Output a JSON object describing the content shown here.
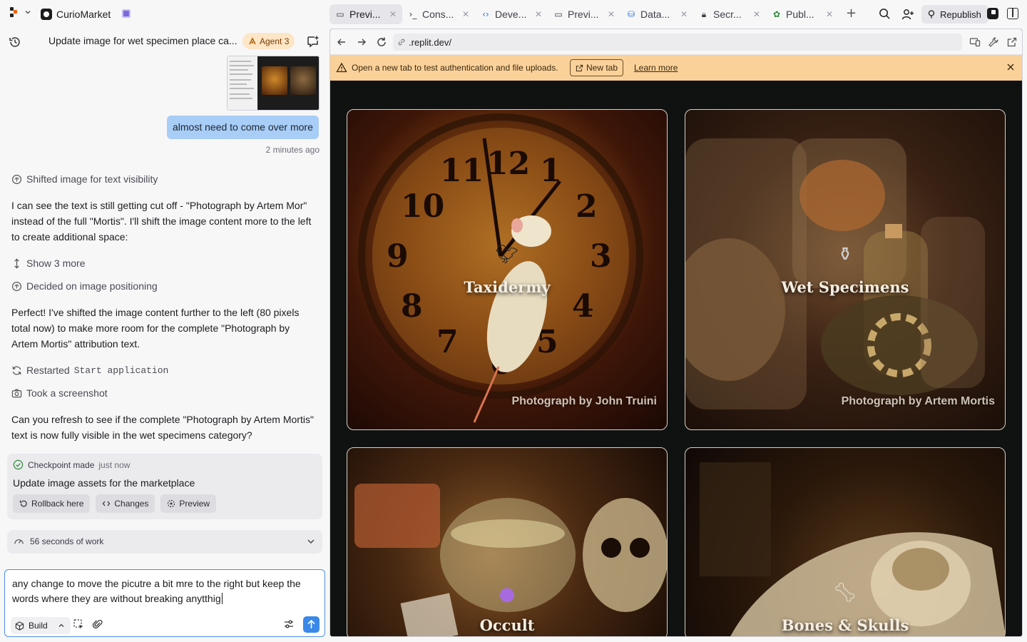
{
  "project": {
    "name": "CurioMarket"
  },
  "tabs": [
    {
      "label": "Previ...",
      "icon": "preview-icon",
      "active": true
    },
    {
      "label": "Cons...",
      "icon": "console-icon",
      "active": false
    },
    {
      "label": "Deve...",
      "icon": "code-icon",
      "active": false
    },
    {
      "label": "Previ...",
      "icon": "preview-icon",
      "active": false
    },
    {
      "label": "Data...",
      "icon": "database-icon",
      "active": false
    },
    {
      "label": "Secr...",
      "icon": "lock-icon",
      "active": false
    },
    {
      "label": "Publ...",
      "icon": "publish-icon",
      "active": false
    }
  ],
  "toolbar": {
    "republish_label": "Republish"
  },
  "chat": {
    "title": "Update image for wet specimen place ca...",
    "agent_badge": "Agent 3",
    "user_message": "almost need to come over more",
    "user_time": "2 minutes ago",
    "step1": "Shifted image for text visibility",
    "msg1": "I can see the text is still getting cut off - \"Photograph by Artem Mor\" instead of the full \"Mortis\". I'll shift the image content more to the left to create additional space:",
    "show_more": "Show 3 more",
    "step2": "Decided on image positioning",
    "msg2": "Perfect! I've shifted the image content further to the left (80 pixels total now) to make more room for the complete \"Photograph by Artem Mortis\" attribution text.",
    "step3_prefix": "Restarted",
    "step3_code": "Start application",
    "step4": "Took a screenshot",
    "msg3": "Can you refresh to see if the complete \"Photograph by Artem Mortis\" text is now fully visible in the wet specimens category?",
    "checkpoint": {
      "label": "Checkpoint made",
      "time": "just now",
      "title": "Update image assets for the marketplace",
      "rollback": "Rollback here",
      "changes": "Changes",
      "preview": "Preview"
    },
    "work_label": "56 seconds of work",
    "composer_text": "any change to move the picutre a bit mre to the right but keep the words where they are without breaking anytthig",
    "build_label": "Build"
  },
  "browser": {
    "url": ".replit.dev/",
    "banner_text": "Open a new tab to test authentication and file uploads.",
    "new_tab_label": "New tab",
    "learn_more": "Learn more"
  },
  "categories": [
    {
      "title": "Taxidermy",
      "credit": "Photograph by John Truini"
    },
    {
      "title": "Wet Specimens",
      "credit": "Photograph by Artem Mortis"
    },
    {
      "title": "Occult",
      "credit": ""
    },
    {
      "title": "Bones & Skulls",
      "credit": ""
    }
  ],
  "colors": {
    "accent": "#3a88e8",
    "banner": "#fbd19a",
    "user_bubble": "#a8cdf7",
    "agent_badge": "#fde6c6"
  }
}
